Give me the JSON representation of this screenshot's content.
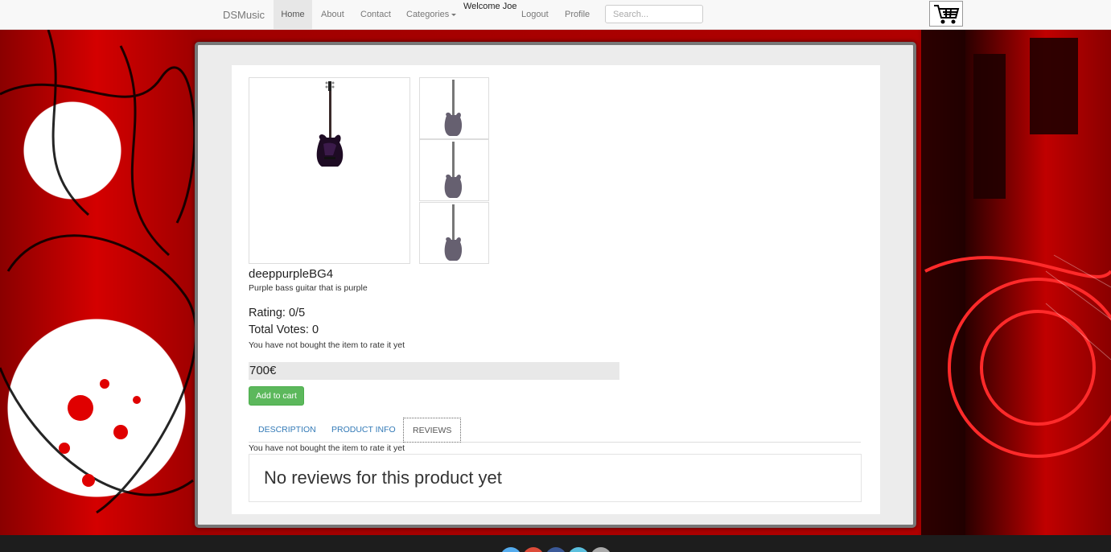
{
  "navbar": {
    "brand": "DSMusic",
    "items": [
      {
        "label": "Home",
        "active": true
      },
      {
        "label": "About"
      },
      {
        "label": "Contact"
      },
      {
        "label": "Categories"
      }
    ],
    "welcome": "Welcome Joe",
    "logout": "Logout",
    "profile": "Profile",
    "search_placeholder": "Search...",
    "cart_icon": "shopping-cart-icon"
  },
  "product": {
    "name": "deeppurpleBG4",
    "description": "Purple bass guitar that is purple",
    "rating": "Rating: 0/5",
    "votes": "Total Votes: 0",
    "rate_note": "You have not bought the item to rate it yet",
    "price": "700€",
    "add_to_cart": "Add to cart"
  },
  "tabs": [
    {
      "label": "DESCRIPTION"
    },
    {
      "label": "PRODUCT INFO"
    },
    {
      "label": "REVIEWS",
      "active": true
    }
  ],
  "reviews": {
    "note": "You have not bought the item to rate it yet",
    "empty_message": "No reviews for this product yet"
  },
  "colors": {
    "accent_link": "#337ab7",
    "button_green": "#5cb85c",
    "background_red": "#b30000"
  }
}
